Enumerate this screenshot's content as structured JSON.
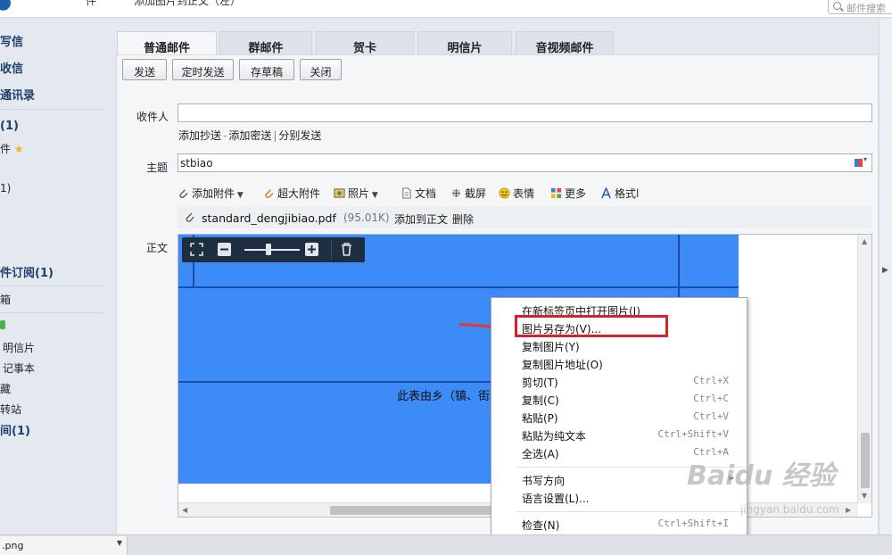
{
  "topbar": {
    "left_partial": "件",
    "faded_text": "添加图片到正文（左）",
    "search_placeholder": "邮件搜索"
  },
  "sidebar": {
    "items": [
      {
        "label": "写信",
        "style": "bold"
      },
      {
        "label": "收信",
        "style": "bold"
      },
      {
        "label": "通讯录",
        "style": "bold"
      },
      {
        "label": "(1)",
        "style": "bold"
      },
      {
        "label": "件",
        "style": "normal"
      },
      {
        "label": "1)",
        "style": "normal"
      },
      {
        "label": "件订阅(1)",
        "style": "bold"
      },
      {
        "label": "箱",
        "style": "normal"
      },
      {
        "label": "明信片",
        "style": "normal"
      },
      {
        "label": "记事本",
        "style": "normal"
      },
      {
        "label": "藏",
        "style": "normal"
      },
      {
        "label": "转站",
        "style": "normal"
      },
      {
        "label": "间(1)",
        "style": "bold"
      }
    ]
  },
  "tabs": [
    "普通邮件",
    "群邮件",
    "贺卡",
    "明信片",
    "音视频邮件"
  ],
  "toolbar": {
    "send": "发送",
    "scheduled": "定时发送",
    "draft": "存草稿",
    "close": "关闭"
  },
  "form": {
    "recipient_label": "收件人",
    "recipient_value": "",
    "cc_link": "添加抄送",
    "bcc_link": "添加密送",
    "separate_link": "分别发送",
    "subject_label": "主题",
    "subject_value": "stbiao",
    "body_label": "正文"
  },
  "tools": {
    "attach": "添加附件",
    "big_attach": "超大附件",
    "photo": "照片",
    "doc": "文档",
    "screenshot": "截屏",
    "emoji": "表情",
    "more": "更多",
    "format": "格式"
  },
  "attachment": {
    "name": "standard_dengjibiao.pdf",
    "size": "(95.01K)",
    "add_to_body": "添加到正文",
    "delete": "删除"
  },
  "image": {
    "text": "此表由乡（镇、街"
  },
  "context_menu": {
    "items": [
      {
        "label": "在新标签页中打开图片(I)",
        "shortcut": ""
      },
      {
        "label": "图片另存为(V)...",
        "shortcut": ""
      },
      {
        "label": "复制图片(Y)",
        "shortcut": ""
      },
      {
        "label": "复制图片地址(O)",
        "shortcut": ""
      },
      {
        "label": "剪切(T)",
        "shortcut": "Ctrl+X"
      },
      {
        "label": "复制(C)",
        "shortcut": "Ctrl+C"
      },
      {
        "label": "粘贴(P)",
        "shortcut": "Ctrl+V"
      },
      {
        "label": "粘贴为纯文本",
        "shortcut": "Ctrl+Shift+V"
      },
      {
        "label": "全选(A)",
        "shortcut": "Ctrl+A"
      },
      {
        "label": "书写方向",
        "shortcut": ""
      },
      {
        "label": "语言设置(L)...",
        "shortcut": ""
      },
      {
        "label": "检查(N)",
        "shortcut": "Ctrl+Shift+I"
      }
    ]
  },
  "watermark": {
    "text": "Baidu 经验",
    "sub": "jingyan.baidu.com"
  },
  "downloads": {
    "file": ".png"
  },
  "colors": {
    "accent_blue": "#3d8bf7",
    "highlight_red": "#d8212b",
    "sidebar_text": "#1c3f6e"
  }
}
